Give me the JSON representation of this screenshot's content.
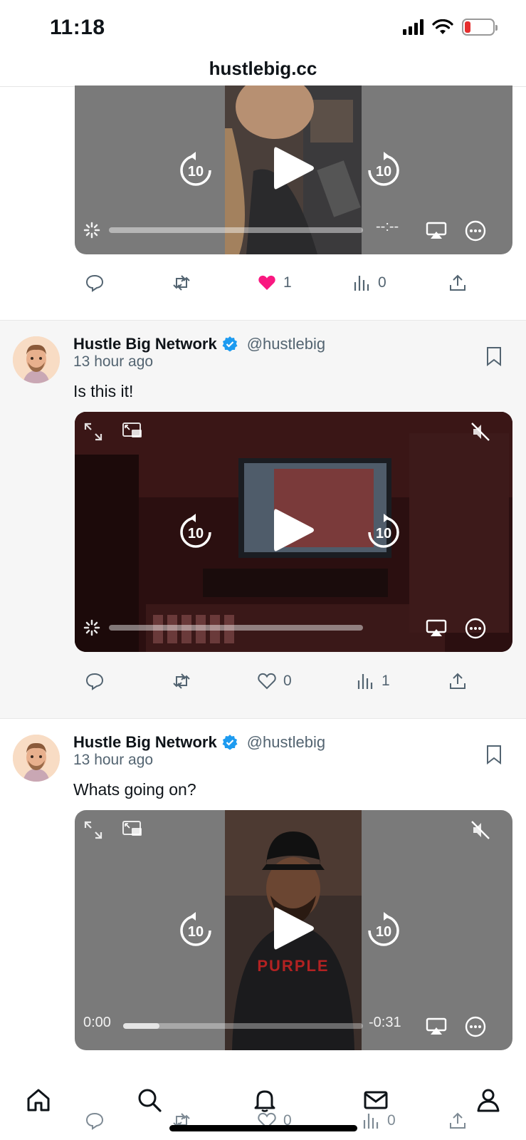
{
  "status_bar": {
    "time": "11:18"
  },
  "browser": {
    "url": "hustlebig.cc"
  },
  "colors": {
    "verified": "#1d9bf0",
    "like": "#f91880",
    "text_secondary": "#536471"
  },
  "posts": [
    {
      "partial": true,
      "video": {
        "time_right": "--:--"
      },
      "actions": {
        "replies": "",
        "reposts": "",
        "likes": "1",
        "liked": true,
        "views": "0"
      }
    },
    {
      "author": "Hustle Big Network",
      "handle": "@hustlebig",
      "time": "13 hour ago",
      "text": "Is this it!",
      "video": {
        "time_right": ""
      },
      "actions": {
        "replies": "",
        "reposts": "",
        "likes": "0",
        "liked": false,
        "views": "1"
      }
    },
    {
      "author": "Hustle Big Network",
      "handle": "@hustlebig",
      "time": "13 hour ago",
      "text": "Whats going on?",
      "video": {
        "time_left": "0:00",
        "time_right": "-0:31",
        "progress": 0.15
      },
      "actions": {
        "replies": "",
        "reposts": "",
        "likes": "0",
        "liked": false,
        "views": "0"
      }
    }
  ],
  "tab_bar": {
    "tabs": [
      "home-icon",
      "search-icon",
      "notifications-bell-icon",
      "messages-mail-icon",
      "profile-icon"
    ]
  },
  "icons": {
    "skip_back": "rewind-10-icon",
    "skip_forward": "forward-10-icon",
    "play": "play-icon",
    "airplay": "airplay-icon",
    "more": "more-icon",
    "fullscreen": "expand-icon",
    "pip": "picture-in-picture-icon",
    "mute": "muted-speaker-icon",
    "skip_label": "10"
  }
}
